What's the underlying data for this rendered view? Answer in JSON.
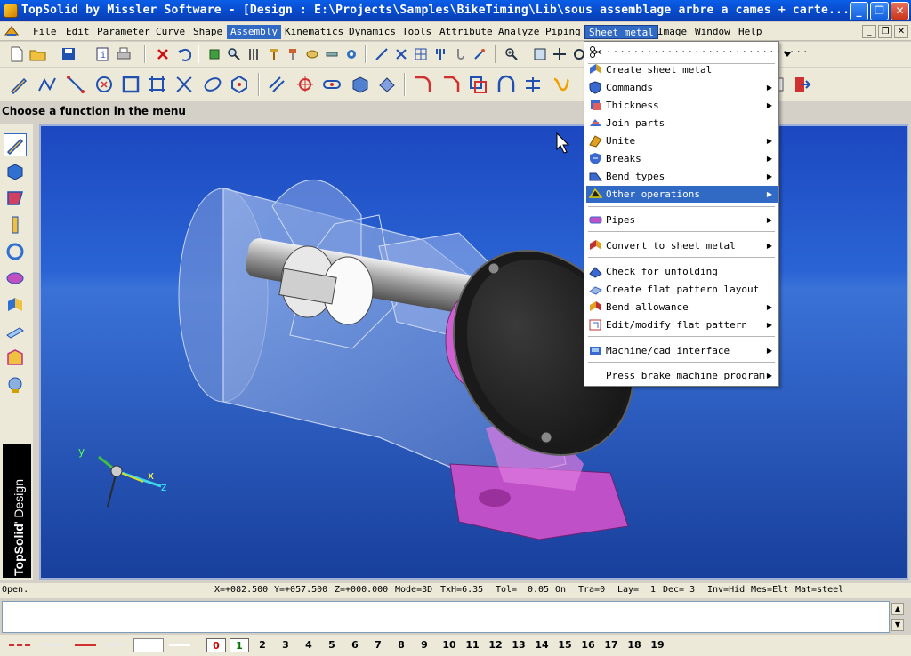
{
  "window": {
    "title": "TopSolid by Missler Software - [Design : E:\\Projects\\Samples\\BikeTiming\\Lib\\sous assemblage arbre a cames + carte...",
    "minimize": "_",
    "maximize": "❐",
    "close": "✕"
  },
  "menubar": {
    "items": [
      "File",
      "Edit",
      "Parameter",
      "Curve",
      "Shape",
      "Assembly",
      "Kinematics",
      "Dynamics",
      "Tools",
      "Attribute",
      "Analyze",
      "Piping",
      "Sheet metal",
      "Image",
      "Window",
      "Help"
    ],
    "highlighted": "Assembly",
    "open": "Sheet metal"
  },
  "prompt": "Choose a function in the menu",
  "dropdown": {
    "items": [
      {
        "label": "Create sheet metal",
        "icon": "sheet-icon",
        "submenu": false
      },
      {
        "label": "Commands",
        "icon": "shield-icon",
        "submenu": true
      },
      {
        "label": "Thickness",
        "icon": "thickness-icon",
        "submenu": true
      },
      {
        "label": "Join parts",
        "icon": "join-icon",
        "submenu": false
      },
      {
        "label": "Unite",
        "icon": "unite-icon",
        "submenu": true
      },
      {
        "label": "Breaks",
        "icon": "breaks-icon",
        "submenu": true
      },
      {
        "label": "Bend types",
        "icon": "bend-icon",
        "submenu": true
      },
      {
        "label": "Other operations",
        "icon": "other-ops-icon",
        "submenu": true
      },
      {
        "label": "Pipes",
        "icon": "pipes-icon",
        "submenu": true
      },
      {
        "label": "Convert to sheet metal",
        "icon": "convert-icon",
        "submenu": true
      },
      {
        "label": "Check for unfolding",
        "icon": "check-icon",
        "submenu": false
      },
      {
        "label": "Create flat pattern layout",
        "icon": "flat-icon",
        "submenu": false
      },
      {
        "label": "Bend allowance",
        "icon": "allowance-icon",
        "submenu": true
      },
      {
        "label": "Edit/modify flat pattern",
        "icon": "edit-flat-icon",
        "submenu": true
      },
      {
        "label": "Machine/cad interface",
        "icon": "machine-icon",
        "submenu": true
      },
      {
        "label": "Press brake machine program",
        "icon": "",
        "submenu": true
      }
    ],
    "highlighted": "Other operations"
  },
  "status": {
    "state": "Open.",
    "x": "X=+082.500",
    "y": "Y=+057.500",
    "z": "Z=+000.000",
    "mode": "Mode=3D",
    "txh": "TxH=6.35",
    "tol_label": "Tol=",
    "tol": "0.05",
    "on": "On",
    "tra": "Tra=0",
    "lay_label": "Lay=",
    "lay": "1",
    "dec": "Dec= 3",
    "inv": "Inv=Hid",
    "mes": "Mes=Elt",
    "mat": "Mat=steel"
  },
  "triad": {
    "x": "x",
    "y": "y",
    "z": "z"
  },
  "brand": {
    "strong": "TopSolid",
    "light": "' Design"
  },
  "layers": [
    "0",
    "1",
    "2",
    "3",
    "4",
    "5",
    "6",
    "7",
    "8",
    "9",
    "10",
    "11",
    "12",
    "13",
    "14",
    "15",
    "16",
    "17",
    "18",
    "19"
  ],
  "colors": {
    "menu_highlight": "#316ac5",
    "title_blue": "#0a52d8",
    "viewport_blue": "#2558c8",
    "magenta_part": "#c050c8"
  }
}
